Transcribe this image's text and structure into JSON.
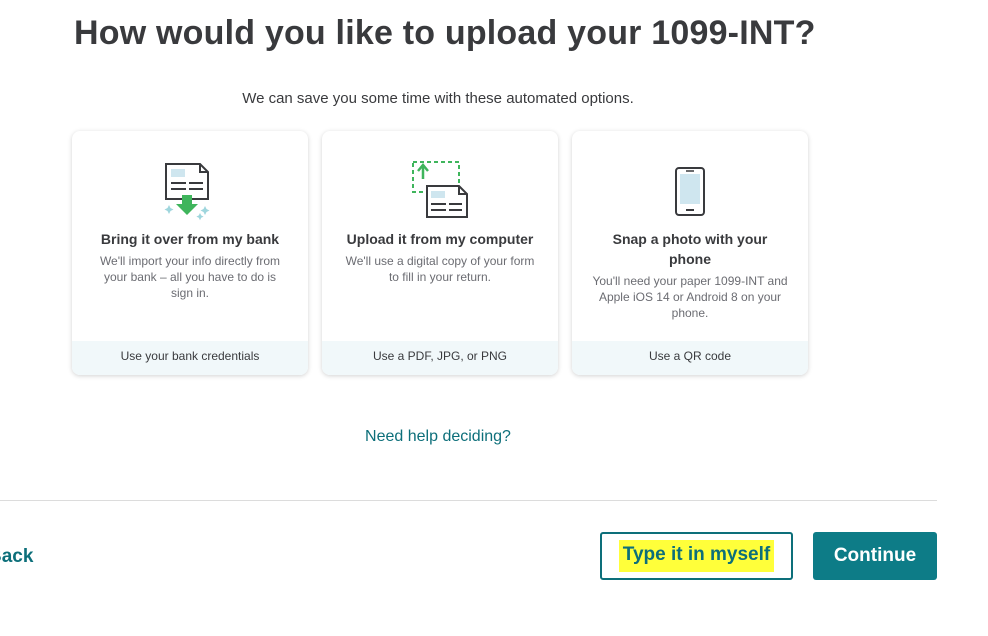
{
  "page": {
    "title": "How would you like to upload your 1099-INT?",
    "subtitle": "We can save you some time with these automated options."
  },
  "options": [
    {
      "title": "Bring it over from my bank",
      "description": "We'll import your info directly from your bank – all you have to do is sign in.",
      "footer": "Use your bank credentials",
      "icon": "bank-import-icon"
    },
    {
      "title": "Upload it from my computer",
      "description": "We'll use a digital copy of your form to fill in your return.",
      "footer": "Use a PDF, JPG, or PNG",
      "icon": "computer-upload-icon"
    },
    {
      "title": "Snap a photo with your phone",
      "description": "You'll need your paper 1099-INT and Apple iOS 14 or Android 8 on your phone.",
      "footer": "Use a QR code",
      "icon": "phone-icon"
    }
  ],
  "help_link": "Need help deciding?",
  "footer": {
    "back_label": "Back",
    "secondary_label": "Type it in myself",
    "primary_label": "Continue"
  },
  "colors": {
    "accent": "#0d6f7a",
    "primary_button": "#0d7c87",
    "highlight": "#ffff3a",
    "icon_green": "#3fb55c",
    "card_footer_bg": "#f1f8fa"
  }
}
